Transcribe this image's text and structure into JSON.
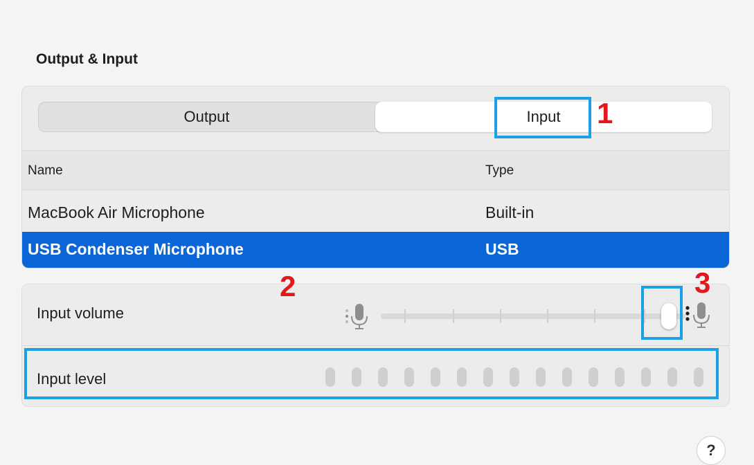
{
  "section_title": "Output & Input",
  "tabs": {
    "output": "Output",
    "input": "Input",
    "selected": "Input"
  },
  "table": {
    "headers": {
      "name": "Name",
      "type": "Type"
    },
    "rows": [
      {
        "name": "MacBook Air Microphone",
        "type": "Built-in",
        "selected": false
      },
      {
        "name": "USB Condenser Microphone",
        "type": "USB",
        "selected": true
      }
    ]
  },
  "input_volume": {
    "label": "Input volume",
    "value_fraction": 0.94,
    "ticks": 7
  },
  "input_level": {
    "label": "Input level",
    "segments": 15,
    "lit": 0
  },
  "annotations": {
    "n1": "1",
    "n2": "2",
    "n3": "3"
  },
  "help_label": "?",
  "colors": {
    "selection": "#0a66d6",
    "annotation_box": "#1aa0e6",
    "annotation_number": "#e3181d"
  }
}
